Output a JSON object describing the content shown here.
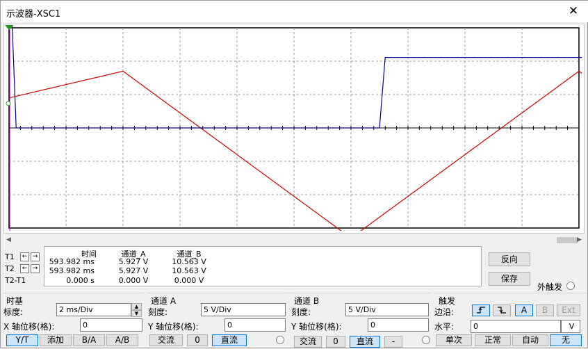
{
  "window": {
    "title": "示波器-XSC1",
    "close_symbol": "✕"
  },
  "scope": {
    "timebase": "2 ms/Div",
    "channel_a_color": "#cc0000",
    "channel_b_color": "#000099",
    "trace_data": {
      "unit_x": "ms",
      "channel_a_triangle": {
        "min_v": -16.5,
        "max_v": 8.5,
        "period_ms": 16.0
      },
      "channel_b_square": {
        "low_v": 0.0,
        "high_v": 10.563
      }
    }
  },
  "readout": {
    "rows": [
      "T1",
      "T2",
      "T2-T1"
    ],
    "headers": [
      "时间",
      "通道_A",
      "通道_B"
    ],
    "t1": {
      "time": "593.982 ms",
      "a": "5.927 V",
      "b": "10.563 V"
    },
    "t2": {
      "time": "593.982 ms",
      "a": "5.927 V",
      "b": "10.563 V"
    },
    "dt": {
      "time": "0.000 s",
      "a": "0.000 V",
      "b": "0.000 V"
    }
  },
  "side": {
    "reverse": "反向",
    "save": "保存",
    "ext_trigger": "外触发"
  },
  "timebase": {
    "title": "时基",
    "scale_label": "标度:",
    "scale_value": "2 ms/Div",
    "xpos_label": "X 轴位移(格):",
    "xpos_value": "0",
    "buttons": [
      "Y/T",
      "添加",
      "B/A",
      "A/B"
    ]
  },
  "channel_a": {
    "title": "通道 A",
    "scale_label": "刻度:",
    "scale_value": "5  V/Div",
    "ypos_label": "Y 轴位移(格):",
    "ypos_value": "0",
    "coupling": [
      "交流",
      "0",
      "直流"
    ]
  },
  "channel_b": {
    "title": "通道 B",
    "scale_label": "刻度:",
    "scale_value": "5  V/Div",
    "ypos_label": "Y 轴位移(格):",
    "ypos_value": "0",
    "coupling": [
      "交流",
      "0",
      "直流",
      "-"
    ]
  },
  "trigger": {
    "title": "触发",
    "edge_label": "边沿:",
    "level_label": "水平:",
    "level_value": "0",
    "level_unit": "V",
    "source_buttons": [
      "A",
      "B",
      "Ext"
    ],
    "mode_buttons": [
      "单次",
      "正常",
      "自动",
      "无"
    ],
    "rise_icon": "rising-edge-icon",
    "fall_icon": "falling-edge-icon"
  }
}
